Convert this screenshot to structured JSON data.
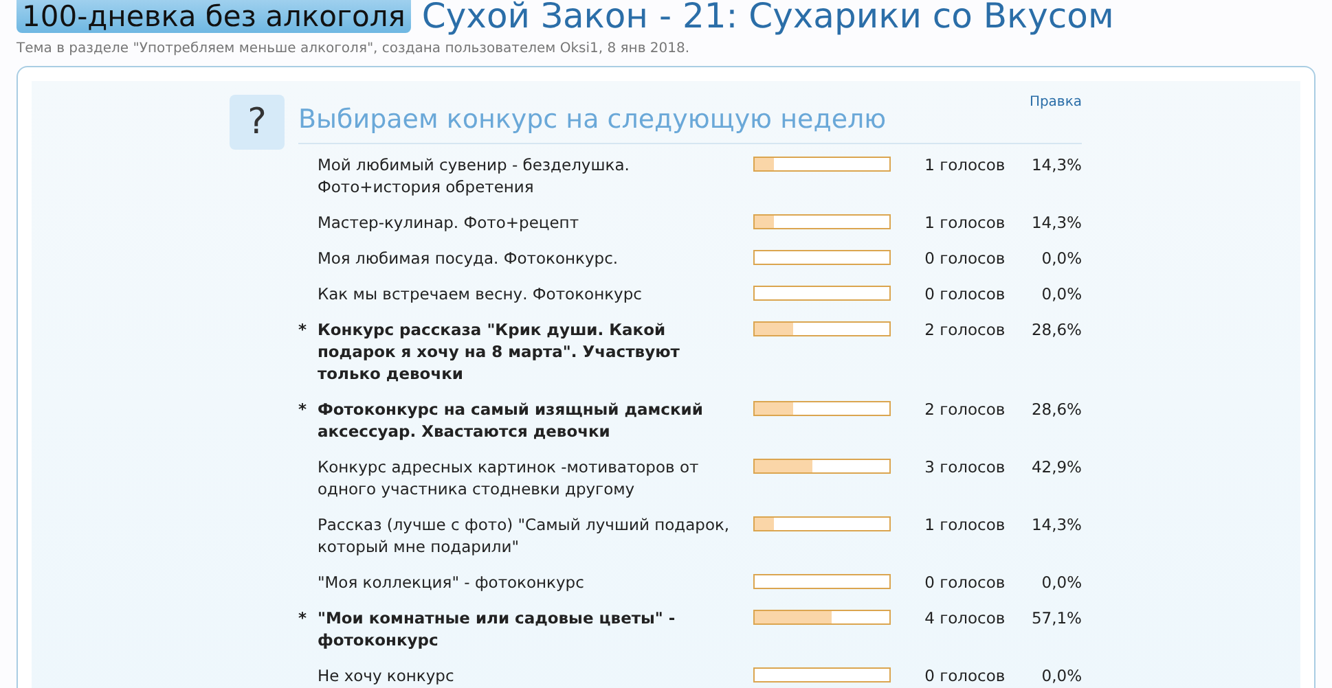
{
  "thread": {
    "prefix": "100-дневка без алкоголя",
    "title": "Сухой Закон - 21: Сухарики со Вкусом",
    "description": "Тема в разделе \"Употребляем меньше алкоголя\", создана пользователем Oksi1, 8 янв 2018."
  },
  "poll": {
    "icon": "?",
    "question": "Выбираем конкурс на следующую неделю",
    "edit_link": "Правка",
    "options": [
      {
        "text": "Мой любимый сувенир - безделушка. Фото+история обретения",
        "voted": false,
        "level": 0.143,
        "votes": "1 голосов",
        "percent": "14,3%"
      },
      {
        "text": "Мастер-кулинар. Фото+рецепт",
        "voted": false,
        "level": 0.143,
        "votes": "1 голосов",
        "percent": "14,3%"
      },
      {
        "text": "Моя любимая посуда. Фотоконкурс.",
        "voted": false,
        "level": 0,
        "votes": "0 голосов",
        "percent": "0,0%"
      },
      {
        "text": "Как мы встречаем весну. Фотоконкурс",
        "voted": false,
        "level": 0,
        "votes": "0 голосов",
        "percent": "0,0%"
      },
      {
        "text": "Конкурс рассказа \"Крик души. Какой подарок я хочу на 8 марта\". Участвуют только девочки",
        "voted": true,
        "marker": "*",
        "level": 0.286,
        "votes": "2 голосов",
        "percent": "28,6%"
      },
      {
        "text": "Фотоконкурс на самый изящный дамский аксессуар. Хвастаются девочки",
        "voted": true,
        "marker": "*",
        "level": 0.286,
        "votes": "2 голосов",
        "percent": "28,6%"
      },
      {
        "text": "Конкурс адресных картинок -мотиваторов от одного участника стодневки другому",
        "voted": false,
        "level": 0.429,
        "votes": "3 голосов",
        "percent": "42,9%"
      },
      {
        "text": "Рассказ (лучше с фото) \"Самый лучший подарок, который мне подарили\"",
        "voted": false,
        "level": 0.143,
        "votes": "1 голосов",
        "percent": "14,3%"
      },
      {
        "text": "\"Моя коллекция\" - фотоконкурс",
        "voted": false,
        "level": 0,
        "votes": "0 голосов",
        "percent": "0,0%"
      },
      {
        "text": "\"Мои комнатные или садовые цветы\" - фотоконкурс",
        "voted": true,
        "marker": "*",
        "level": 0.571,
        "votes": "4 голосов",
        "percent": "57,1%"
      },
      {
        "text": "Не хочу конкурс",
        "voted": false,
        "level": 0,
        "votes": "0 голосов",
        "percent": "0,0%"
      }
    ]
  }
}
